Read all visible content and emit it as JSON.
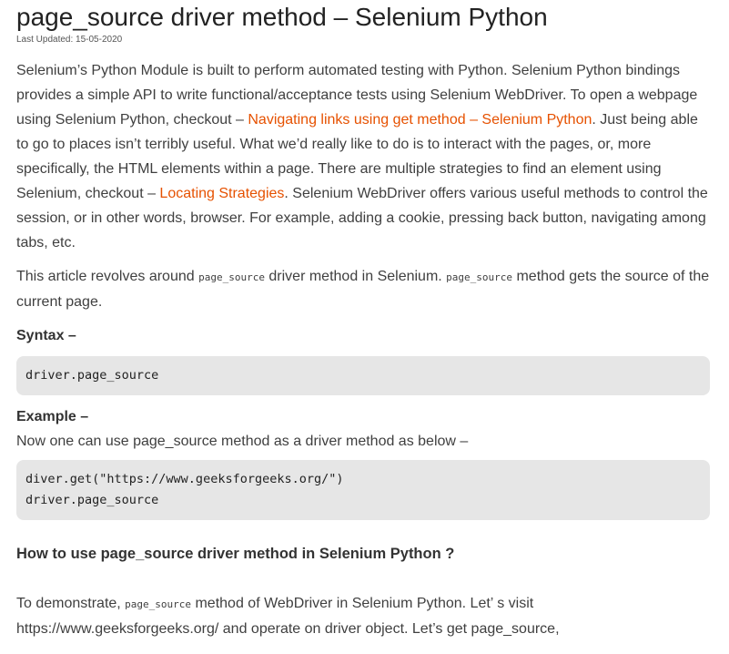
{
  "article": {
    "title": "page_source driver method – Selenium Python",
    "last_updated": "Last Updated: 15-05-2020",
    "intro": {
      "text1": "Selenium’s Python Module is built to perform automated testing with Python. Selenium Python bindings provides a simple API to write functional/acceptance tests using Selenium WebDriver. To open a webpage using Selenium Python, checkout – ",
      "link1": "Navigating links using get method – Selenium Python",
      "text2": ". Just being able to go to places isn’t terribly useful. What we’d really like to do is to interact with the pages, or, more specifically, the HTML elements within a page. There are multiple strategies to find an element using Selenium, checkout – ",
      "link2": "Locating Strategies",
      "text3": ". Selenium WebDriver offers various useful methods to control the session, or in other words, browser. For example, adding a cookie, pressing back button, navigating among tabs, etc."
    },
    "about": {
      "text1": "This article revolves around ",
      "code1": "page_source",
      "text2": " driver method in Selenium. ",
      "code2": "page_source",
      "text3": " method gets the source of the current page."
    },
    "syntax_label": "Syntax –",
    "syntax_code": "driver.page_source",
    "example_label": "Example –",
    "example_text": "Now one can use page_source method as a driver method as below –",
    "example_code": "diver.get(\"https://www.geeksforgeeks.org/\")\ndriver.page_source",
    "section_heading": "How to use page_source driver method in Selenium Python ?",
    "demo": {
      "text1": "To demonstrate, ",
      "code1": "page_source",
      "text2": " method of WebDriver in Selenium Python. Let’ s visit https://www.geeksforgeeks.org/ and operate on driver object. Let’s get page_source,"
    }
  },
  "colors": {
    "link": "#e65100",
    "code_background": "#e6e6e6",
    "body_text": "#3f3f3f"
  }
}
